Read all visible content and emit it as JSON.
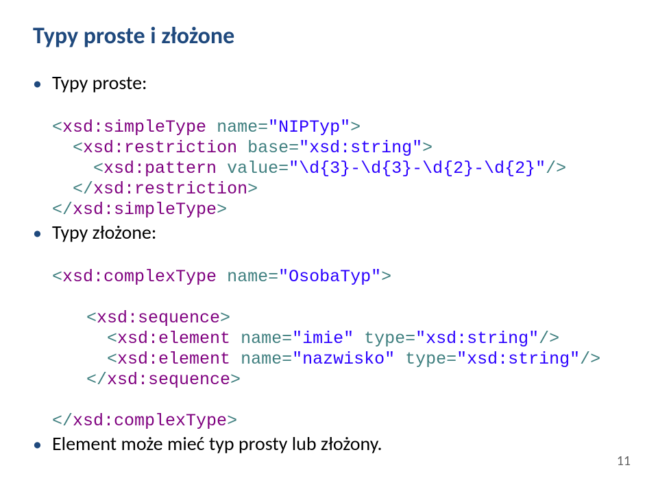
{
  "title": "Typy proste i złożone",
  "bullet1": "Typy proste:",
  "code1_l1_a": "<",
  "code1_l1_tag": "xsd:simpleType",
  "code1_l1_b": " name=",
  "code1_l1_str": "\"NIPTyp\"",
  "code1_l1_c": ">",
  "code1_l2_a": "<",
  "code1_l2_tag": "xsd:restriction",
  "code1_l2_b": " base=",
  "code1_l2_str": "\"xsd:string\"",
  "code1_l2_c": ">",
  "code1_l3_a": "<",
  "code1_l3_tag": "xsd:pattern",
  "code1_l3_b": " value=",
  "code1_l3_str": "\"\\d{3}-\\d{3}-\\d{2}-\\d{2}\"",
  "code1_l3_c": "/>",
  "code1_l4_a": "</",
  "code1_l4_tag": "xsd:restriction",
  "code1_l4_b": ">",
  "code1_l5_a": "</",
  "code1_l5_tag": "xsd:simpleType",
  "code1_l5_b": ">",
  "bullet2": "Typy złożone:",
  "code2_l1_a": "<",
  "code2_l1_tag": "xsd:complexType",
  "code2_l1_b": " name=",
  "code2_l1_str": "\"OsobaTyp\"",
  "code2_l1_c": ">",
  "code2_l2_a": "<",
  "code2_l2_tag": "xsd:sequence",
  "code2_l2_b": ">",
  "code2_l3_a": "<",
  "code2_l3_tag": "xsd:element",
  "code2_l3_b": " name=",
  "code2_l3_str1": "\"imie\"",
  "code2_l3_c": " type=",
  "code2_l3_str2": "\"xsd:string\"",
  "code2_l3_d": "/>",
  "code2_l4_a": "<",
  "code2_l4_tag": "xsd:element",
  "code2_l4_b": " name=",
  "code2_l4_str1": "\"nazwisko\"",
  "code2_l4_c": " type=",
  "code2_l4_str2": "\"xsd:string\"",
  "code2_l4_d": "/>",
  "code2_l5_a": "</",
  "code2_l5_tag": "xsd:sequence",
  "code2_l5_b": ">",
  "code2_l6_a": "</",
  "code2_l6_tag": "xsd:complexType",
  "code2_l6_b": ">",
  "bullet3": "Element może mieć typ prosty lub złożony.",
  "page_num": "11"
}
